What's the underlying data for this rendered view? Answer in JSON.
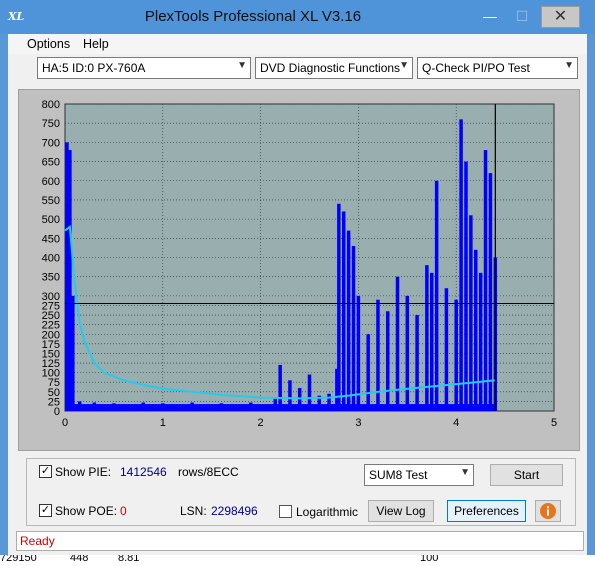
{
  "window": {
    "title": "PlexTools Professional XL V3.16",
    "icon_text": "XL",
    "minimize": "—",
    "maximize": "☐",
    "close": "✕"
  },
  "menu": {
    "options": "Options",
    "help": "Help"
  },
  "combos": {
    "drive": "HA:5 ID:0  PX-760A",
    "function": "DVD Diagnostic Functions",
    "test": "Q-Check PI/PO Test"
  },
  "chart_data": {
    "type": "bar",
    "xlim": [
      0,
      5
    ],
    "ylim": [
      0,
      800
    ],
    "x_ticks": [
      "0",
      "1",
      "2",
      "3",
      "4",
      "5"
    ],
    "y_ticks": [
      "0",
      "25",
      "50",
      "75",
      "100",
      "125",
      "150",
      "175",
      "200",
      "225",
      "250",
      "275",
      "300",
      "350",
      "400",
      "450",
      "500",
      "550",
      "600",
      "650",
      "700",
      "750",
      "800"
    ],
    "reference_line": 280,
    "end_marker_x": 4.4,
    "series": [
      {
        "kind": "bars",
        "x": [
          0.02,
          0.05,
          0.08,
          0.15,
          0.3,
          0.5,
          0.8,
          1.0,
          1.3,
          1.6,
          1.9,
          2.15,
          2.2,
          2.3,
          2.4,
          2.5,
          2.6,
          2.7,
          2.78,
          2.8,
          2.85,
          2.9,
          2.95,
          3.0,
          3.1,
          3.2,
          3.3,
          3.4,
          3.5,
          3.6,
          3.7,
          3.75,
          3.8,
          3.9,
          4.0,
          4.05,
          4.1,
          4.15,
          4.2,
          4.25,
          4.3,
          4.35,
          4.4
        ],
        "y": [
          700,
          680,
          300,
          25,
          22,
          20,
          22,
          20,
          22,
          20,
          22,
          35,
          120,
          80,
          60,
          95,
          40,
          45,
          110,
          540,
          520,
          470,
          430,
          300,
          200,
          290,
          260,
          350,
          300,
          250,
          380,
          360,
          600,
          320,
          290,
          760,
          650,
          510,
          420,
          360,
          680,
          620,
          400
        ]
      },
      {
        "kind": "line",
        "x": [
          0,
          0.05,
          0.1,
          0.15,
          0.2,
          0.3,
          0.4,
          0.6,
          0.8,
          1.0,
          1.3,
          1.6,
          2.0,
          2.4,
          2.7,
          2.9,
          3.2,
          3.5,
          3.8,
          4.0,
          4.2,
          4.4
        ],
        "y": [
          470,
          480,
          330,
          230,
          180,
          125,
          100,
          80,
          68,
          58,
          50,
          42,
          35,
          33,
          35,
          40,
          50,
          58,
          65,
          70,
          75,
          80
        ]
      }
    ]
  },
  "controls": {
    "show_pie_label": "Show PIE:",
    "pie_value": "1412546",
    "pie_unit": "rows/8ECC",
    "show_poe_label": "Show POE:",
    "poe_value": "0",
    "lsn_label": "LSN:",
    "lsn_value": "2298496",
    "logarithmic_label": "Logarithmic",
    "sum_select": "SUM8 Test",
    "start_button": "Start",
    "view_log_button": "View Log",
    "preferences_button": "Preferences",
    "info_icon": "info-icon"
  },
  "status_text": "Ready",
  "background_text": [
    "729150",
    "448",
    "8.81",
    "100"
  ],
  "colors": {
    "plot_bg": "#98aeaf",
    "bars": "#0000ff",
    "line": "#22ccee",
    "titlebar": "#4f93d8",
    "status_text": "#d00000",
    "pie_value": "#00008b",
    "poe_value": "#d00000"
  }
}
